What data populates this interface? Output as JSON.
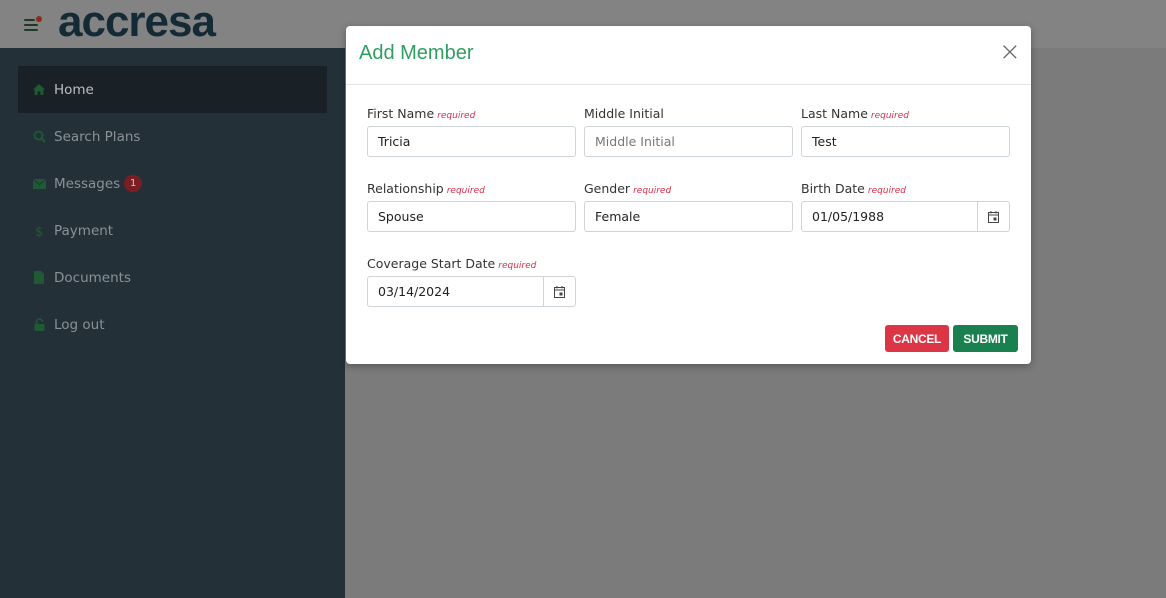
{
  "header": {
    "logo_text": "accresa"
  },
  "sidebar": {
    "items": [
      {
        "label": "Home",
        "icon": "home-icon"
      },
      {
        "label": "Search Plans",
        "icon": "search-icon"
      },
      {
        "label": "Messages",
        "icon": "envelope-icon",
        "badge": "1"
      },
      {
        "label": "Payment",
        "icon": "dollar-icon"
      },
      {
        "label": "Documents",
        "icon": "document-icon"
      },
      {
        "label": "Log out",
        "icon": "lock-icon"
      }
    ]
  },
  "modal": {
    "title": "Add Member",
    "close_symbol": "×",
    "required_text": "required",
    "fields": {
      "first_name": {
        "label": "First Name",
        "value": "Tricia"
      },
      "middle_initial": {
        "label": "Middle Initial",
        "placeholder": "Middle Initial"
      },
      "last_name": {
        "label": "Last Name",
        "value": "Test"
      },
      "relationship": {
        "label": "Relationship",
        "value": "Spouse"
      },
      "gender": {
        "label": "Gender",
        "value": "Female"
      },
      "birth_date": {
        "label": "Birth Date",
        "value": "01/05/1988"
      },
      "coverage_start_date": {
        "label": "Coverage Start Date",
        "value": "03/14/2024"
      }
    },
    "cancel_label": "CANCEL",
    "submit_label": "SUBMIT"
  },
  "colors": {
    "accent_green": "#2f9e62",
    "submit_green": "#1a8050",
    "cancel_red": "#dc3545",
    "required_red": "#dc2f4a",
    "sidebar_bg": "#243038"
  }
}
